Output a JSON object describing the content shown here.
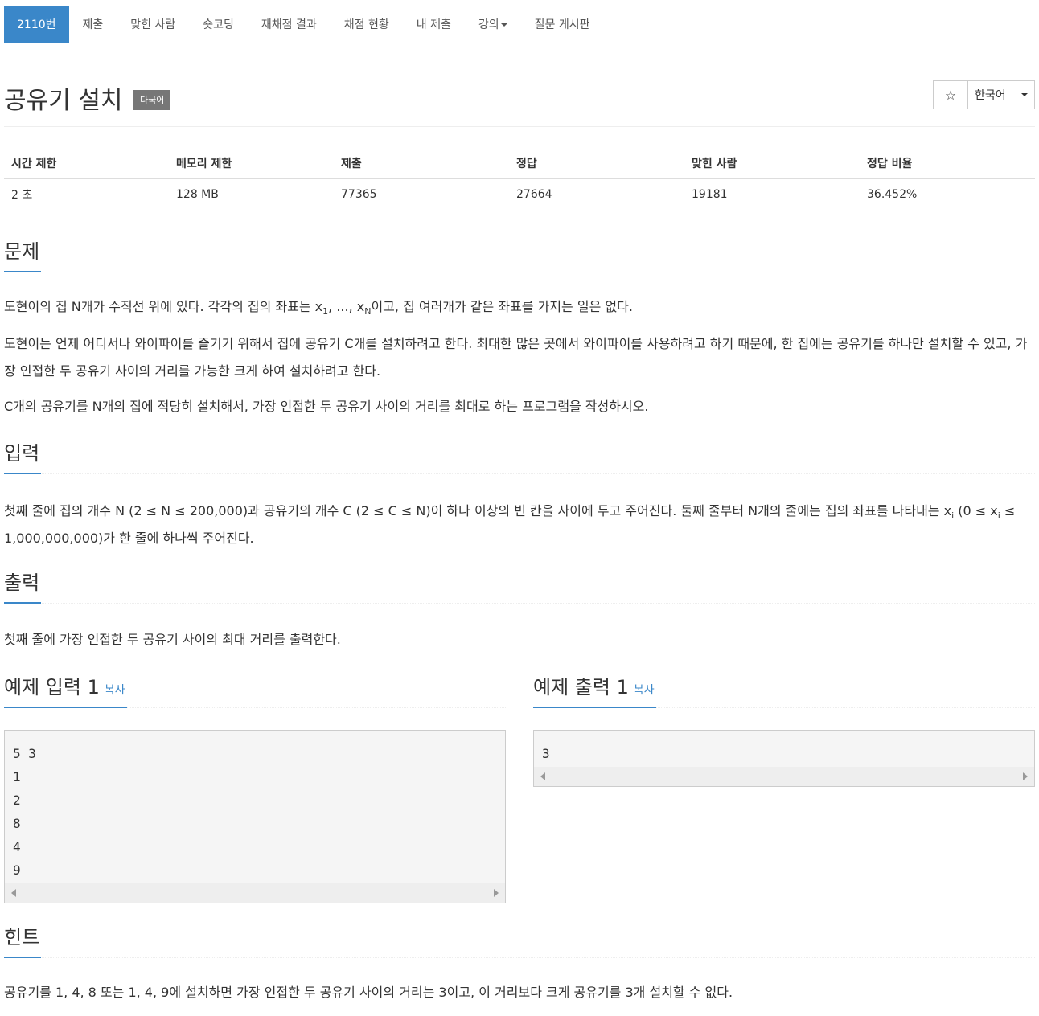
{
  "nav": {
    "items": [
      "2110번",
      "제출",
      "맞힌 사람",
      "숏코딩",
      "재채점 결과",
      "채점 현황",
      "내 제출",
      "강의",
      "질문 게시판"
    ]
  },
  "problem": {
    "title": "공유기 설치",
    "badge": "다국어",
    "star": "☆",
    "language": "한국어"
  },
  "stats": {
    "headers": [
      "시간 제한",
      "메모리 제한",
      "제출",
      "정답",
      "맞힌 사람",
      "정답 비율"
    ],
    "values": [
      "2 초",
      "128 MB",
      "77365",
      "27664",
      "19181",
      "36.452%"
    ]
  },
  "sections": {
    "problem_title": "문제",
    "p1_a": "도현이의 집 N개가 수직선 위에 있다. 각각의 집의 좌표는 x",
    "p1_sub1": "1",
    "p1_b": ", ..., x",
    "p1_subN": "N",
    "p1_c": "이고, 집 여러개가 같은 좌표를 가지는 일은 없다.",
    "p2": "도현이는 언제 어디서나 와이파이를 즐기기 위해서 집에 공유기 C개를 설치하려고 한다. 최대한 많은 곳에서 와이파이를 사용하려고 하기 때문에, 한 집에는 공유기를 하나만 설치할 수 있고, 가장 인접한 두 공유기 사이의 거리를 가능한 크게 하여 설치하려고 한다.",
    "p3": "C개의 공유기를 N개의 집에 적당히 설치해서, 가장 인접한 두 공유기 사이의 거리를 최대로 하는 프로그램을 작성하시오.",
    "input_title": "입력",
    "input_a": "첫째 줄에 집의 개수 N (2 ≤ N ≤ 200,000)과 공유기의 개수 C (2 ≤ C ≤ N)이 하나 이상의 빈 칸을 사이에 두고 주어진다. 둘째 줄부터 N개의 줄에는 집의 좌표를 나타내는 x",
    "input_subi": "i",
    "input_b": " (0 ≤ x",
    "input_subi2": "i",
    "input_c": " ≤ 1,000,000,000)가 한 줄에 하나씩 주어진다.",
    "output_title": "출력",
    "output_text": "첫째 줄에 가장 인접한 두 공유기 사이의 최대 거리를 출력한다.",
    "hint_title": "힌트",
    "hint_text": "공유기를 1, 4, 8 또는 1, 4, 9에 설치하면 가장 인접한 두 공유기 사이의 거리는 3이고, 이 거리보다 크게 공유기를 3개 설치할 수 없다."
  },
  "samples": {
    "input_title": "예제 입력 1",
    "output_title": "예제 출력 1",
    "copy_label": "복사",
    "input_text": "5 3\n1\n2\n8\n4\n9",
    "output_text": "3"
  }
}
